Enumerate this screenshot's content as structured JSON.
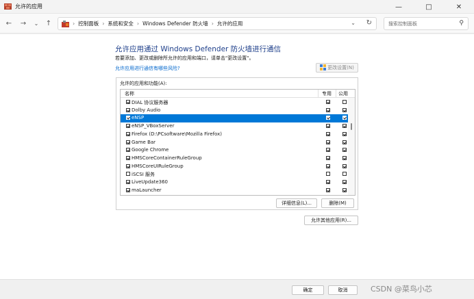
{
  "window": {
    "title": "允许的应用"
  },
  "address": {
    "crumbs": [
      "控制面板",
      "系统和安全",
      "Windows Defender 防火墙",
      "允许的应用"
    ],
    "separator": "›",
    "search_placeholder": "搜索控制面板"
  },
  "main": {
    "heading": "允许应用通过 Windows Defender 防火墙进行通信",
    "subtext": "若要添加、更改或删除所允许的应用和端口，请单击\"更改设置\"。",
    "risk_link": "允许应用进行通信有哪些风险?",
    "change_settings_label": "更改设置(N)",
    "panel_label": "允许的应用和功能(A):",
    "columns": {
      "name": "名称",
      "private": "专用",
      "public": "公用"
    },
    "apps": [
      {
        "name": "DIAL 协议服务器",
        "enabled": true,
        "private": true,
        "public": false
      },
      {
        "name": "Dolby Audio",
        "enabled": true,
        "private": true,
        "public": true
      },
      {
        "name": "eNSP",
        "enabled": true,
        "private": true,
        "public": true,
        "selected": true
      },
      {
        "name": "eNSP_VBoxServer",
        "enabled": true,
        "private": true,
        "public": true
      },
      {
        "name": "Firefox (D:\\PCsoftware\\Mozilla Firefox)",
        "enabled": true,
        "private": true,
        "public": true
      },
      {
        "name": "Game Bar",
        "enabled": true,
        "private": true,
        "public": true
      },
      {
        "name": "Google Chrome",
        "enabled": true,
        "private": true,
        "public": true
      },
      {
        "name": "HMSCoreContainerRuleGroup",
        "enabled": true,
        "private": true,
        "public": true
      },
      {
        "name": "HMSCoreUIRuleGroup",
        "enabled": true,
        "private": true,
        "public": true
      },
      {
        "name": "iSCSI 服务",
        "enabled": false,
        "private": false,
        "public": false
      },
      {
        "name": "LiveUpdate360",
        "enabled": true,
        "private": true,
        "public": true
      },
      {
        "name": "maLauncher",
        "enabled": true,
        "private": true,
        "public": true
      }
    ],
    "details_label": "详细信息(L)...",
    "remove_label": "删除(M)",
    "allow_other_label": "允许其他应用(R)..."
  },
  "footer": {
    "ok_label": "确定",
    "cancel_label": "取消",
    "watermark": "CSDN @菜鸟小芯"
  }
}
